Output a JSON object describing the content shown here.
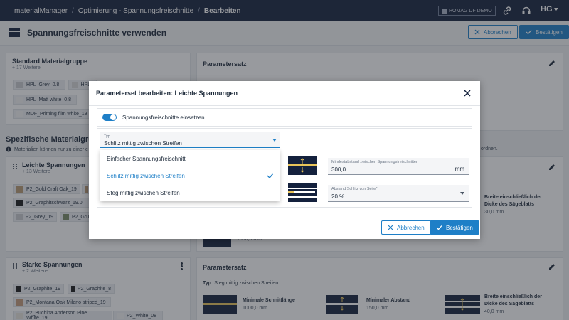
{
  "topbar": {
    "breadcrumbs": [
      "materialManager",
      "Optimierung - Spannungsfreischnitte",
      "Bearbeiten"
    ],
    "company": "HOMAG DF DEMO",
    "brand": "HG"
  },
  "page": {
    "title": "Spannungsfreischnitte verwenden",
    "cancel": "Abbrechen",
    "confirm": "Bestätigen"
  },
  "standard_group": {
    "title": "Standard Materialgruppe",
    "more": "+ 17 Weitere",
    "chips": [
      "HPL_Grey_0.8",
      "HPL_",
      "HPL_Matt white_0.8",
      "MDF_Priming film white_19"
    ]
  },
  "specific": {
    "title": "Spezifische Materialgruppe",
    "hint_left": "Materialien können nur zu einer e",
    "hint_right": "ordnen."
  },
  "light": {
    "title": "Leichte Spannungen",
    "more": "+ 13 Weitere",
    "chips": [
      "P2_Gold Craft Oak_19",
      "P2_Graphitschwarz_19.0",
      "P2_Grey_19",
      "P2_Grun"
    ]
  },
  "strong": {
    "title": "Starke Spannungen",
    "more": "+ 2 Weitere",
    "chips": [
      "P2_Graphite_19",
      "P2_Graphite_8",
      "P2_Montana Oak Milano striped_19",
      "P2_Buchina Anderson Pine White_19",
      "P2_White_08"
    ]
  },
  "paramset": {
    "title": "Parametersatz",
    "type_label": "Typ:",
    "type_value": "Steg mittig zwischen Streifen",
    "min_cut_label": "Minimale Schnittlänge",
    "min_cut_value": "1000,0 mm",
    "min_dist_label": "Minimaler Abstand",
    "min_dist_value": "150,0 mm",
    "width_label": "Breite einschließlich der Dicke des Sägeblatts",
    "width_value": "40,0 mm",
    "width_value_upper": "30,0 mm",
    "partial_value": "1000,0 mm"
  },
  "modal": {
    "title": "Parameterset bearbeiten: Leichte Spannungen",
    "toggle_label": "Spannungsfreischnitte einsetzen",
    "toggle_on": true,
    "select_label": "Typ",
    "select_value": "Schlitz mittig zwischen Streifen",
    "options": [
      "Einfacher Spannungsfreischnitt",
      "Schlitz mittig zwischen Streifen",
      "Steg mittig zwischen Streifen"
    ],
    "selected_index": 1,
    "min_dist_label": "Mindestabstand zwischen Spannungsfreischnitten",
    "min_dist_value": "300,0",
    "min_dist_unit": "mm",
    "slot_dist_label": "Abstand Schlitz von Seite*",
    "slot_dist_value": "20 %",
    "cancel": "Abbrechen",
    "confirm": "Bestätigen"
  },
  "colors": {
    "navy": "#14213d",
    "accent": "#1e7fc7",
    "gold": "#e8c45a"
  }
}
